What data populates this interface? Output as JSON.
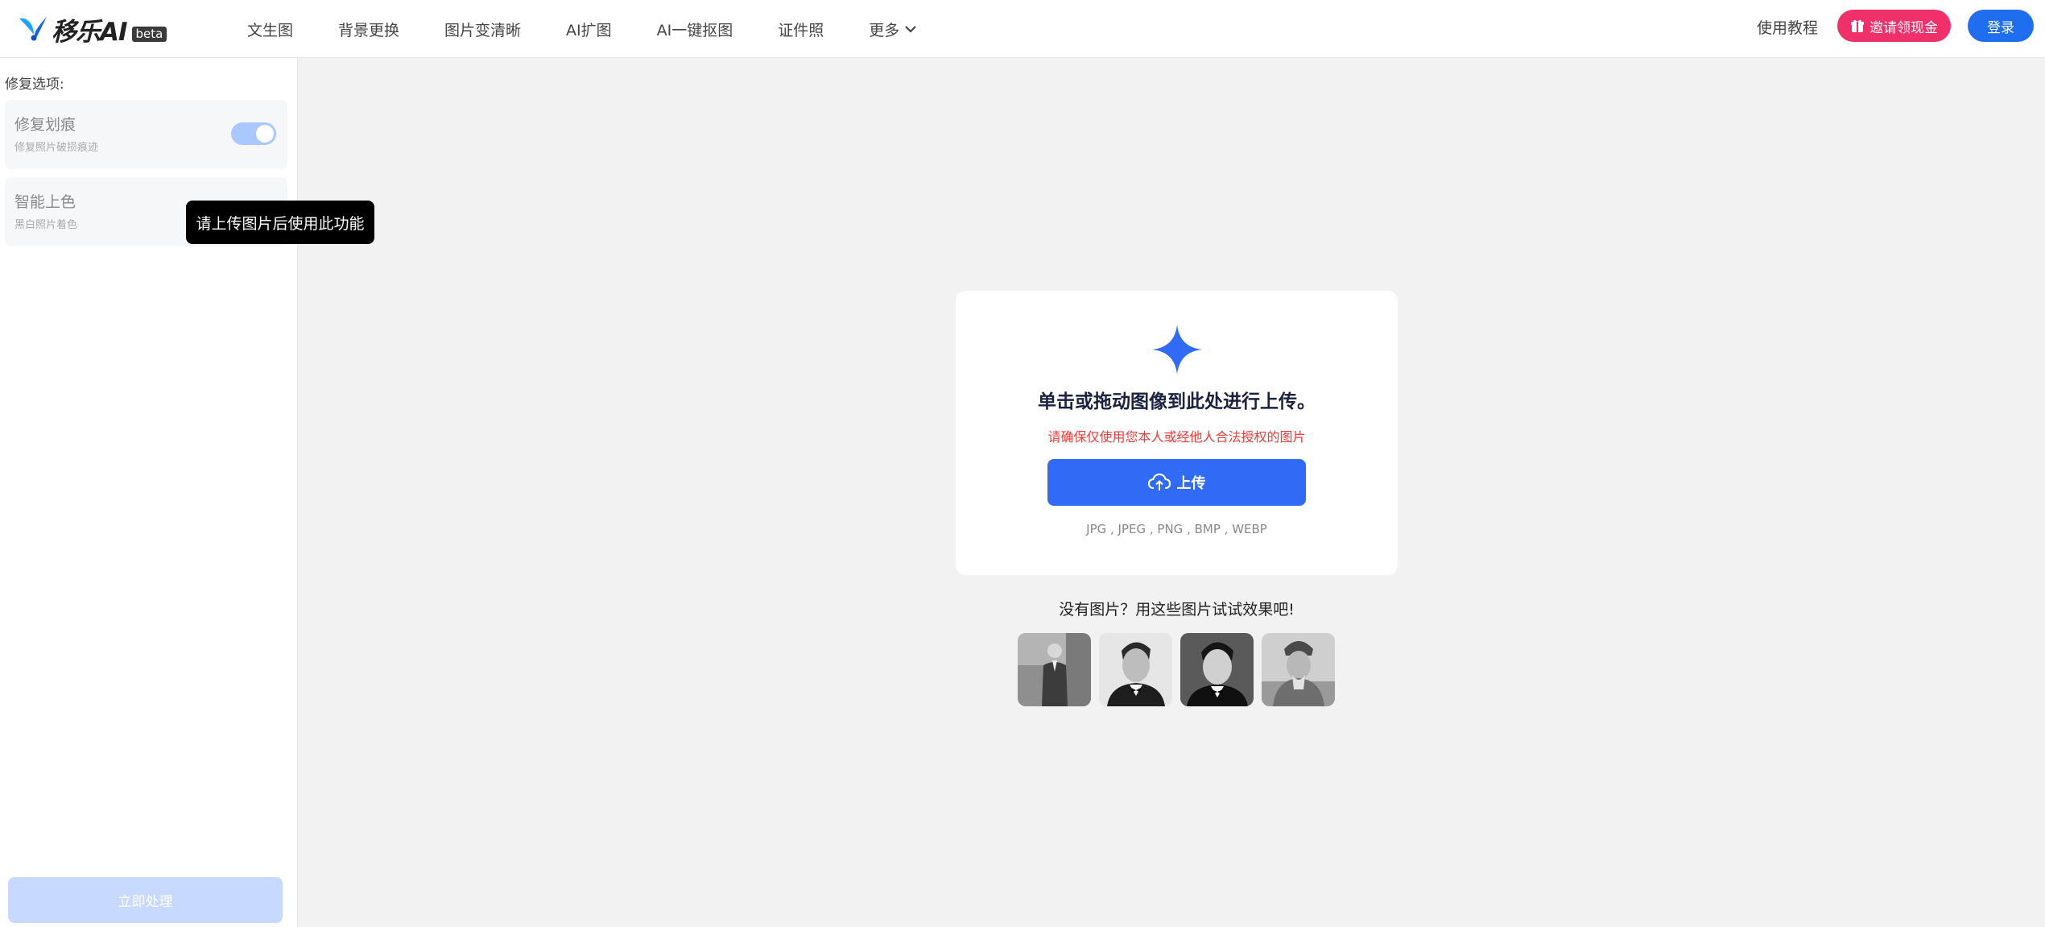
{
  "header": {
    "logo_text": "移乐AI",
    "beta_badge": "beta",
    "nav": [
      {
        "label": "文生图"
      },
      {
        "label": "背景更换"
      },
      {
        "label": "图片变清晰"
      },
      {
        "label": "AI扩图"
      },
      {
        "label": "AI一键抠图"
      },
      {
        "label": "证件照"
      },
      {
        "label": "更多"
      }
    ],
    "tutorial": "使用教程",
    "invite": "邀请领现金",
    "login": "登录"
  },
  "sidebar": {
    "section_label": "修复选项:",
    "options": [
      {
        "title": "修复划痕",
        "subtitle": "修复照片破损痕迹",
        "toggle_on": true
      },
      {
        "title": "智能上色",
        "subtitle": "黑白照片着色"
      }
    ],
    "tooltip": "请上传图片后使用此功能",
    "process_button": "立即处理"
  },
  "upload": {
    "title": "单击或拖动图像到此处进行上传。",
    "warning": "请确保仅使用您本人或经他人合法授权的图片",
    "button": "上传",
    "formats": "JPG , JPEG , PNG , BMP , WEBP"
  },
  "samples": {
    "label": "没有图片？用这些图片试试效果吧!"
  },
  "colors": {
    "primary": "#2f6bf5",
    "invite": "#f0306a",
    "warning": "#f03a3a",
    "toggle": "#a8c8ff",
    "disabled_button": "#c7d9ff"
  }
}
